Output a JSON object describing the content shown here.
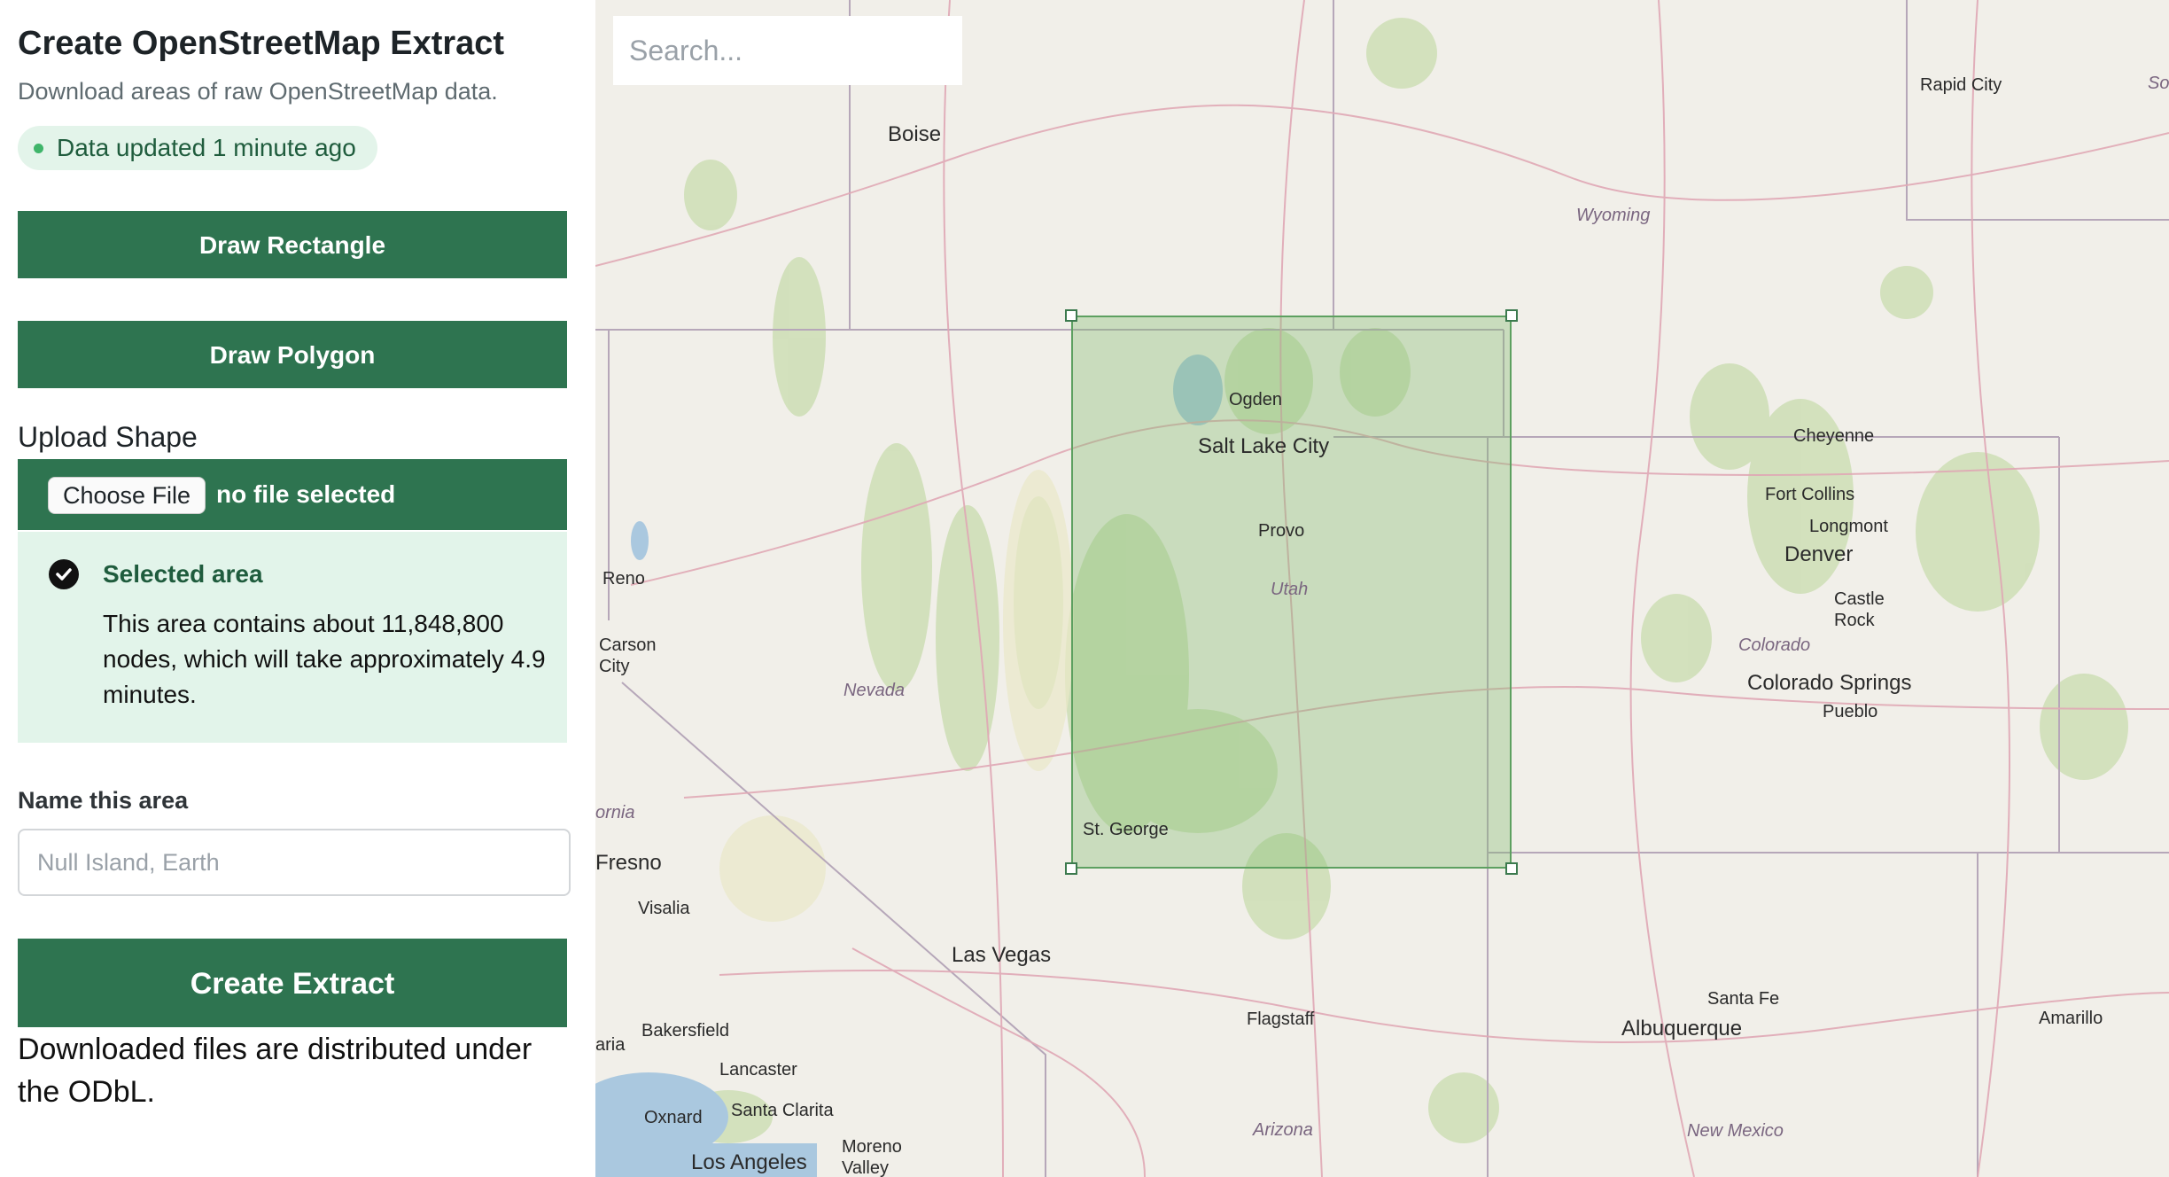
{
  "header": {
    "title": "Create OpenStreetMap Extract",
    "subtitle": "Download areas of raw OpenStreetMap data.",
    "status": "Data updated 1 minute ago"
  },
  "actions": {
    "draw_rectangle": "Draw Rectangle",
    "draw_polygon": "Draw Polygon"
  },
  "upload": {
    "label": "Upload Shape",
    "choose_button": "Choose File",
    "file_status": "no file selected"
  },
  "selection": {
    "title": "Selected area",
    "description": "This area contains about 11,848,800 nodes, which will take approximately 4.9 minutes."
  },
  "name_field": {
    "label": "Name this area",
    "placeholder": "Null Island, Earth",
    "value": ""
  },
  "create_button": "Create Extract",
  "license_text": "Downloaded files are distributed under the ODbL.",
  "map": {
    "search_placeholder": "Search...",
    "labels": {
      "boise": "Boise",
      "rapid_city": "Rapid City",
      "so": "So",
      "wyoming": "Wyoming",
      "ogden": "Ogden",
      "salt_lake_city": "Salt Lake City",
      "provo": "Provo",
      "utah": "Utah",
      "cheyenne": "Cheyenne",
      "fort_collins": "Fort Collins",
      "longmont": "Longmont",
      "denver": "Denver",
      "castle_rock": "Castle\nRock",
      "colorado": "Colorado",
      "colorado_springs": "Colorado Springs",
      "pueblo": "Pueblo",
      "reno": "Reno",
      "carson_city": "Carson\nCity",
      "nevada": "Nevada",
      "ornia": "ornia",
      "fresno": "Fresno",
      "visalia": "Visalia",
      "st_george": "St. George",
      "las_vegas": "Las Vegas",
      "flagstaff": "Flagstaff",
      "santa_fe": "Santa Fe",
      "albuquerque": "Albuquerque",
      "amarillo": "Amarillo",
      "bakersfield": "Bakersfield",
      "aria": "aria",
      "lancaster": "Lancaster",
      "oxnard": "Oxnard",
      "santa_clarita": "Santa Clarita",
      "moreno_valley": "Moreno\nValley",
      "los_angeles": "Los Angeles",
      "arizona": "Arizona",
      "new_mexico": "New Mexico"
    }
  },
  "colors": {
    "primary": "#2e7450",
    "status_bg": "#e3f4ea",
    "selection_bg": "#e2f4ea",
    "map_bg": "#f1efe9",
    "selection_fill": "#7db96e"
  }
}
